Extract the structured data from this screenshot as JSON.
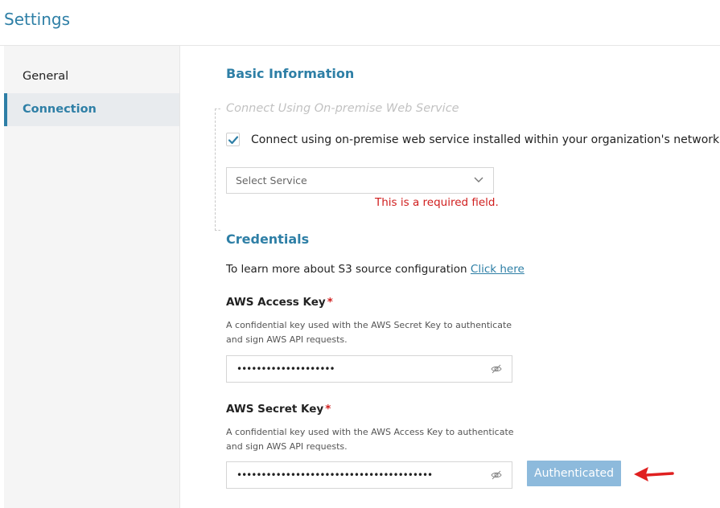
{
  "header": {
    "title": "Settings"
  },
  "sidebar": {
    "items": [
      {
        "label": "General",
        "active": false
      },
      {
        "label": "Connection",
        "active": true
      }
    ]
  },
  "basic_info": {
    "title": "Basic Information",
    "onprem_heading": "Connect Using On-premise Web Service",
    "checkbox_label": "Connect using on-premise web service installed within your organization's network",
    "checkbox_checked": true,
    "select_placeholder": "Select Service",
    "error_text": "This is a required field."
  },
  "credentials": {
    "title": "Credentials",
    "learn_text": "To learn more about S3 source configuration ",
    "learn_link": "Click here",
    "access_key": {
      "label": "AWS Access Key",
      "required_mark": "*",
      "help": "A confidential key used with the AWS Secret Key to authenticate and sign AWS API requests.",
      "value": "••••••••••••••••••••"
    },
    "secret_key": {
      "label": "AWS Secret Key",
      "required_mark": "*",
      "help": "A confidential key used with the AWS Access Key to authenticate and sign AWS API requests.",
      "value": "••••••••••••••••••••••••••••••••••••••••"
    },
    "auth_button": "Authenticated"
  },
  "colors": {
    "accent": "#2e7fa6",
    "error": "#d01e1e",
    "button": "#8dbadc",
    "arrow": "#e02020"
  },
  "icons": {
    "check": "check-icon",
    "chevron": "chevron-down-icon",
    "eye": "eye-off-icon",
    "arrow": "left-arrow-icon"
  }
}
